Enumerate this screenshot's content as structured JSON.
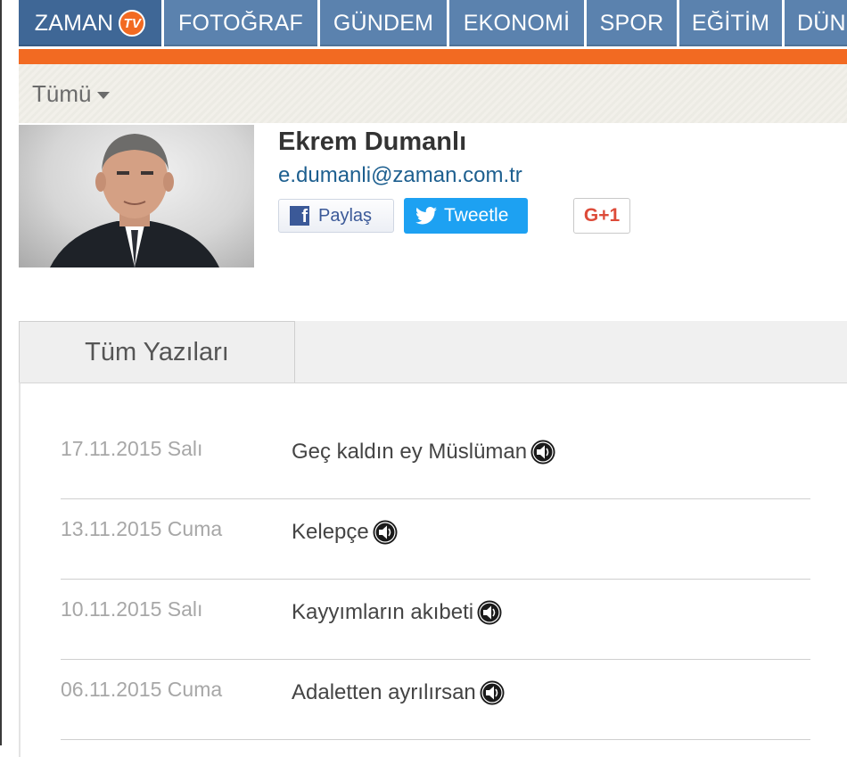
{
  "nav": {
    "brand": "ZAMAN",
    "brand_tv": "TV",
    "items": [
      "FOTOĞRAF",
      "GÜNDEM",
      "EKONOMİ",
      "SPOR",
      "EĞİTİM",
      "DÜN"
    ]
  },
  "filter": {
    "label": "Tümü"
  },
  "author": {
    "name": "Ekrem Dumanlı",
    "email": "e.dumanli@zaman.com.tr"
  },
  "share": {
    "facebook_label": "Paylaş",
    "twitter_label": "Tweetle",
    "gplus_label": "G+1"
  },
  "tabs": {
    "active_label": "Tüm Yazıları"
  },
  "articles": [
    {
      "date": "17.11.2015 Salı",
      "title": "Geç kaldın ey Müslüman"
    },
    {
      "date": "13.11.2015 Cuma",
      "title": "Kelepçe"
    },
    {
      "date": "10.11.2015 Salı",
      "title": "Kayyımların akıbeti"
    },
    {
      "date": "06.11.2015 Cuma",
      "title": "Adaletten ayrılırsan"
    }
  ],
  "colors": {
    "nav_blue": "#5b82ae",
    "brand_blue": "#3f6796",
    "accent_orange": "#f26a22",
    "twitter_blue": "#1da1f2",
    "facebook_blue": "#3b5998",
    "gplus_red": "#dd4b39"
  }
}
